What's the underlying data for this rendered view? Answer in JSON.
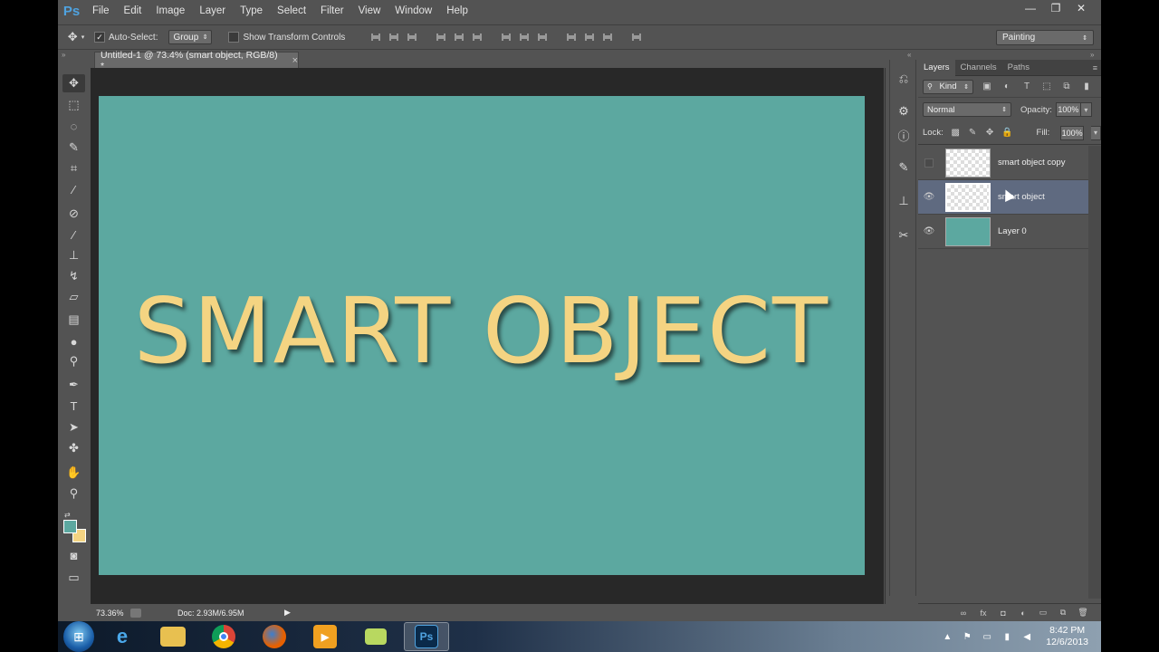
{
  "app": {
    "logo": "Ps"
  },
  "menu": [
    "File",
    "Edit",
    "Image",
    "Layer",
    "Type",
    "Select",
    "Filter",
    "View",
    "Window",
    "Help"
  ],
  "window_controls": {
    "minimize": "—",
    "restore": "❐",
    "close": "✕"
  },
  "options_bar": {
    "auto_select_label": "Auto-Select:",
    "auto_select_checked": true,
    "auto_select_mode": "Group",
    "show_transform_label": "Show Transform Controls",
    "workspace": "Painting"
  },
  "document": {
    "tab_title": "Untitled-1 @ 73.4% (smart object, RGB/8) *",
    "canvas_text": "SMART OBJECT",
    "canvas_bg_color": "#5ca8a0",
    "text_color": "#f4d482"
  },
  "status_bar": {
    "zoom": "73.36%",
    "doc_size": "Doc: 2.93M/6.95M"
  },
  "colors": {
    "foreground": "#5ca8a0",
    "background": "#f4d482"
  },
  "layers_panel": {
    "tabs": [
      "Layers",
      "Channels",
      "Paths"
    ],
    "filter_kind": "Kind",
    "blend_mode": "Normal",
    "opacity_label": "Opacity:",
    "opacity_value": "100%",
    "lock_label": "Lock:",
    "fill_label": "Fill:",
    "fill_value": "100%",
    "layers": [
      {
        "name": "smart object copy",
        "visible": false,
        "selected": false
      },
      {
        "name": "smart object",
        "visible": true,
        "selected": true
      },
      {
        "name": "Layer 0",
        "visible": true,
        "selected": false
      }
    ]
  },
  "taskbar": {
    "clock_time": "8:42 PM",
    "clock_date": "12/6/2013",
    "active_app": "Ps"
  }
}
